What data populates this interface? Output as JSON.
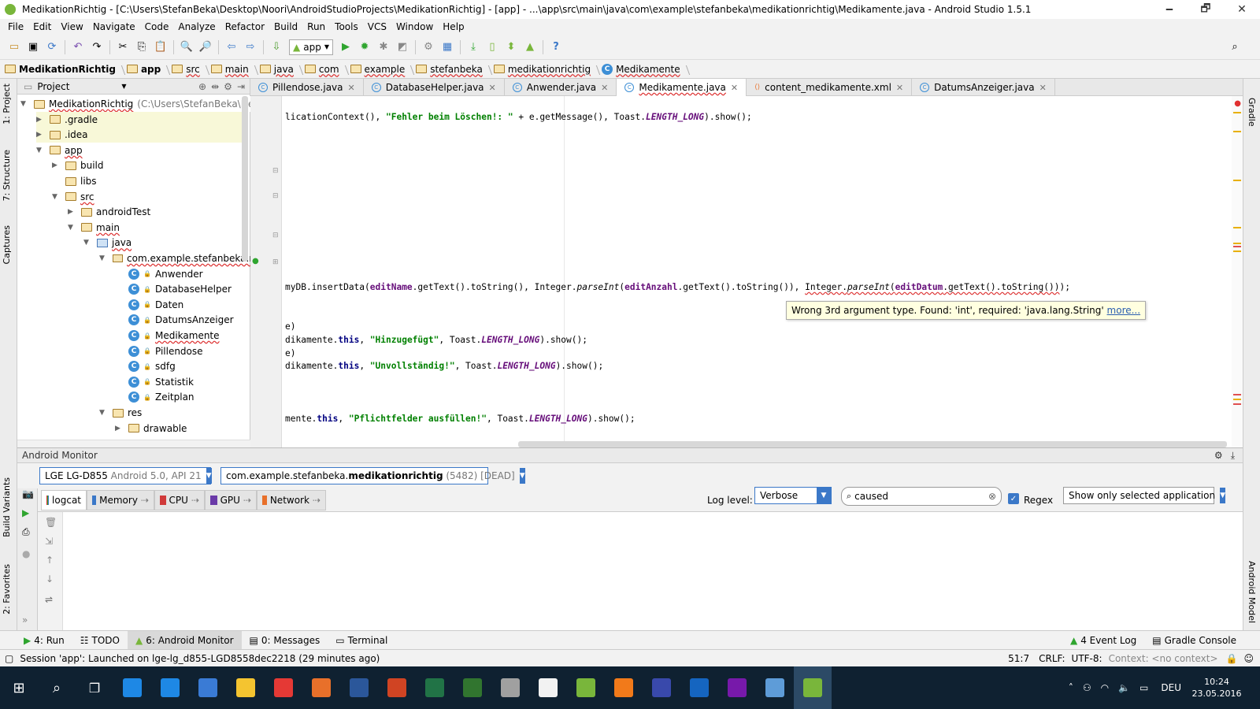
{
  "window": {
    "title": "MedikationRichtig - [C:\\Users\\StefanBeka\\Desktop\\Noori\\AndroidStudioProjects\\MedikationRichtig] - [app] - ...\\app\\src\\main\\java\\com\\example\\stefanbeka\\medikationrichtig\\Medikamente.java - Android Studio 1.5.1",
    "minimize": "🗕",
    "maximize": "🗗",
    "close": "✕"
  },
  "menu": [
    "File",
    "Edit",
    "View",
    "Navigate",
    "Code",
    "Analyze",
    "Refactor",
    "Build",
    "Run",
    "Tools",
    "VCS",
    "Window",
    "Help"
  ],
  "toolbar": {
    "run_config": "app"
  },
  "breadcrumb": [
    "MedikationRichtig",
    "app",
    "src",
    "main",
    "java",
    "com",
    "example",
    "stefanbeka",
    "medikationrichtig",
    "Medikamente"
  ],
  "side_tabs_left": [
    "1: Project",
    "7: Structure",
    "Captures",
    "Build Variants",
    "2: Favorites"
  ],
  "side_tabs_right": [
    "Gradle",
    "Android Model"
  ],
  "project": {
    "header": "Project",
    "tree": [
      {
        "label": "MedikationRichtig",
        "extra": "(C:\\Users\\StefanBeka\\Desk",
        "depth": 0,
        "kind": "folder",
        "open": true
      },
      {
        "label": ".gradle",
        "depth": 1,
        "kind": "folder",
        "open": false
      },
      {
        "label": ".idea",
        "depth": 1,
        "kind": "folder",
        "open": false
      },
      {
        "label": "app",
        "depth": 1,
        "kind": "folder",
        "open": true
      },
      {
        "label": "build",
        "depth": 2,
        "kind": "folder",
        "open": false
      },
      {
        "label": "libs",
        "depth": 2,
        "kind": "folder",
        "open": null
      },
      {
        "label": "src",
        "depth": 2,
        "kind": "folder",
        "open": true
      },
      {
        "label": "androidTest",
        "depth": 3,
        "kind": "folder",
        "open": false
      },
      {
        "label": "main",
        "depth": 3,
        "kind": "folder",
        "open": true
      },
      {
        "label": "java",
        "depth": 4,
        "kind": "src",
        "open": true
      },
      {
        "label": "com.example.stefanbeka.n",
        "depth": 5,
        "kind": "pkg",
        "open": true
      },
      {
        "label": "Anwender",
        "depth": 6,
        "kind": "class"
      },
      {
        "label": "DatabaseHelper",
        "depth": 6,
        "kind": "class"
      },
      {
        "label": "Daten",
        "depth": 6,
        "kind": "class"
      },
      {
        "label": "DatumsAnzeiger",
        "depth": 6,
        "kind": "class"
      },
      {
        "label": "Medikamente",
        "depth": 6,
        "kind": "class"
      },
      {
        "label": "Pillendose",
        "depth": 6,
        "kind": "class"
      },
      {
        "label": "sdfg",
        "depth": 6,
        "kind": "class"
      },
      {
        "label": "Statistik",
        "depth": 6,
        "kind": "class"
      },
      {
        "label": "Zeitplan",
        "depth": 6,
        "kind": "class"
      },
      {
        "label": "res",
        "depth": 5,
        "kind": "folder",
        "open": true
      },
      {
        "label": "drawable",
        "depth": 6,
        "kind": "folder",
        "open": false
      }
    ]
  },
  "tabs": [
    {
      "label": "Pillendose.java",
      "active": false
    },
    {
      "label": "DatabaseHelper.java",
      "active": false
    },
    {
      "label": "Anwender.java",
      "active": false
    },
    {
      "label": "Medikamente.java",
      "active": true
    },
    {
      "label": "content_medikamente.xml",
      "active": false
    },
    {
      "label": "DatumsAnzeiger.java",
      "active": false
    }
  ],
  "code": {
    "line1_a": "licationContext(), ",
    "line1_str": "\"Fehler beim Löschen!: \"",
    "line1_b": " + e.getMessage(), Toast.",
    "line1_fld": "LENGTH_LONG",
    "line1_c": ").show();",
    "line2_a": "myDB.insertData(",
    "line2_f1": "editName",
    "line2_b": ".getText().toString(), Integer.",
    "line2_m": "parseInt",
    "line2_c": "(",
    "line2_f2": "editAnzahl",
    "line2_d": ".getText().toString()), ",
    "line2_err1": "Integer.",
    "line2_err2": "parseInt",
    "line2_err3": "(",
    "line2_f3": "editDatum",
    "line2_err4": ".getText().toString())",
    "line2_e": ");",
    "line3": "e)",
    "line4_a": "dikamente.",
    "line4_kw": "this",
    "line4_b": ", ",
    "line4_str": "\"Hinzugefügt\"",
    "line4_c": ", Toast.",
    "line4_fld": "LENGTH_LONG",
    "line4_d": ").show();",
    "line5": "e)",
    "line6_a": "dikamente.",
    "line6_kw": "this",
    "line6_b": ", ",
    "line6_str": "\"Unvollständig!\"",
    "line6_c": ", Toast.",
    "line6_fld": "LENGTH_LONG",
    "line6_d": ").show();",
    "line7_a": "mente.",
    "line7_kw": "this",
    "line7_b": ", ",
    "line7_str": "\"Pflichtfelder ausfüllen!\"",
    "line7_c": ", Toast.",
    "line7_fld": "LENGTH_LONG",
    "line7_d": ").show();"
  },
  "tooltip": {
    "text": "Wrong 3rd argument type. Found: 'int', required: 'java.lang.String'",
    "link": "more..."
  },
  "monitor": {
    "title": "Android Monitor",
    "device": "LGE LG-D855",
    "device_extra": "Android 5.0, API 21",
    "process": "com.example.stefanbeka.",
    "process_bold": "medikationrichtig",
    "process_extra": "(5482) [DEAD]",
    "tabs": [
      "logcat",
      "Memory",
      "CPU",
      "GPU",
      "Network"
    ],
    "log_level_label": "Log level:",
    "log_level": "Verbose",
    "search_value": "caused",
    "regex_label": "Regex",
    "filter": "Show only selected application"
  },
  "bottom_tabs": [
    "4: Run",
    "TODO",
    "6: Android Monitor",
    "0: Messages",
    "Terminal"
  ],
  "bottom_right_tabs": [
    "4 Event Log",
    "Gradle Console"
  ],
  "status": {
    "message": "Session 'app': Launched on lge-lg_d855-LGD8558dec2218 (29 minutes ago)",
    "position": "51:7",
    "line_sep": "CRLF:",
    "encoding": "UTF-8:",
    "context": "Context: <no context>"
  },
  "taskbar": {
    "lang": "DEU",
    "time": "10:24",
    "date": "23.05.2016",
    "colors": [
      "#1e88e5",
      "#1e88e5",
      "#3a7bd5",
      "#f4c430",
      "#e53935",
      "#e8702a",
      "#2b579a",
      "#d04423",
      "#217346",
      "#31752f",
      "#a0a0a0",
      "#f2f2f2",
      "#79b63b",
      "#f27a1a",
      "#3949ab",
      "#1565c0",
      "#7719aa",
      "#5e9cd8",
      "#79b63b"
    ]
  }
}
